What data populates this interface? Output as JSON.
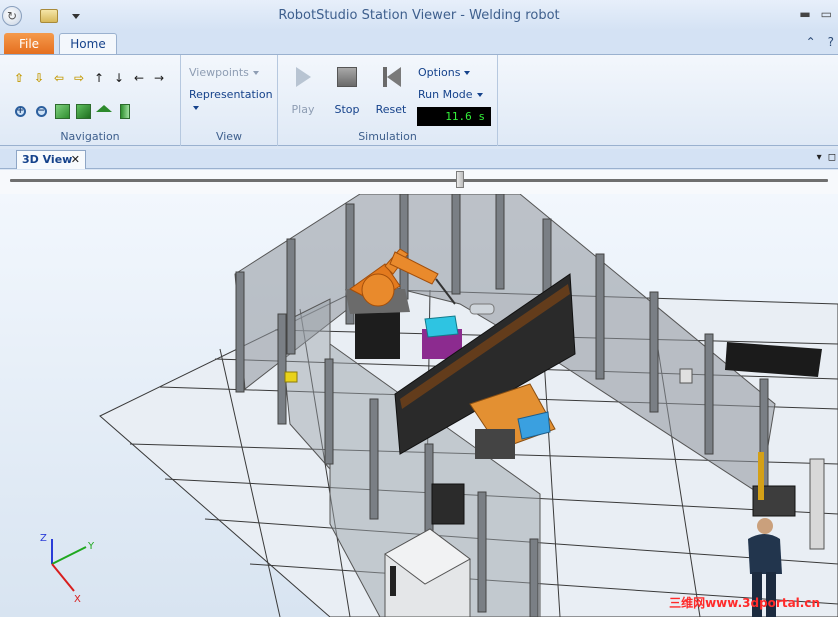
{
  "window": {
    "title": "RobotStudio Station Viewer - Welding robot"
  },
  "tabs": {
    "file": "File",
    "home": "Home"
  },
  "ribbon": {
    "navigation": {
      "group_label": "Navigation"
    },
    "view": {
      "viewpoints": "Viewpoints",
      "representation": "Representation",
      "group_label": "View"
    },
    "simulation": {
      "play": "Play",
      "stop": "Stop",
      "reset": "Reset",
      "options": "Options",
      "run_mode": "Run Mode",
      "time": "11.6 s",
      "group_label": "Simulation"
    }
  },
  "document_tab": {
    "label": "3D View",
    "close": "✕"
  },
  "timeline": {
    "position": 0.55
  },
  "axes": {
    "x": "X",
    "y": "Y",
    "z": "Z"
  },
  "watermark": "三维网www.3dportal.cn"
}
